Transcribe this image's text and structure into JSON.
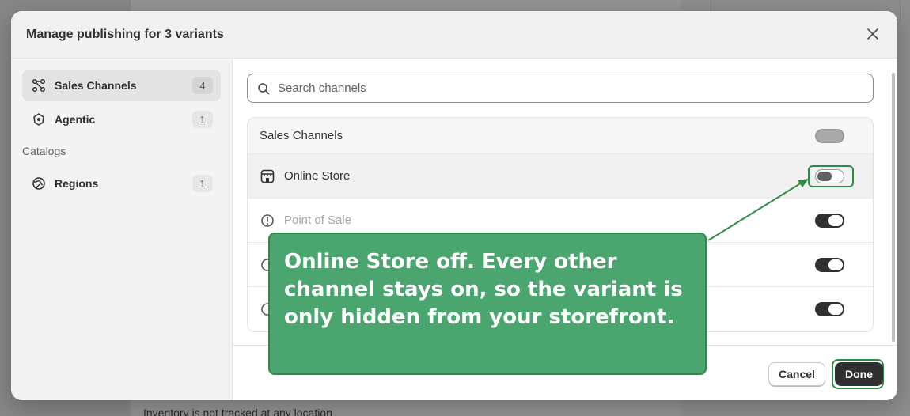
{
  "background": {
    "footer_text": "Inventory is not tracked at any location"
  },
  "modal": {
    "title": "Manage publishing for 3 variants",
    "close_icon": "close-icon"
  },
  "sidebar": {
    "items": [
      {
        "label": "Sales Channels",
        "count": "4",
        "icon": "channels-icon",
        "active": true
      },
      {
        "label": "Agentic",
        "count": "1",
        "icon": "agentic-icon",
        "active": false
      }
    ],
    "section_label": "Catalogs",
    "catalog_items": [
      {
        "label": "Regions",
        "count": "1",
        "icon": "globe-icon"
      }
    ]
  },
  "search": {
    "placeholder": "Search channels",
    "value": ""
  },
  "channels": {
    "header": "Sales Channels",
    "rows": [
      {
        "label": "Online Store",
        "icon": "store-icon",
        "state": "off",
        "highlighted": true
      },
      {
        "label": "Point of Sale",
        "icon": "alert-icon",
        "state": "on",
        "muted": true
      }
    ],
    "hidden_row_states": [
      "on",
      "on"
    ]
  },
  "footer": {
    "cancel_label": "Cancel",
    "done_label": "Done"
  },
  "annotation": {
    "text": "Online Store off. Every other channel stays on, so the variant is only hidden from your storefront.",
    "color": "#4aa56f",
    "border_color": "#2e8b46"
  }
}
